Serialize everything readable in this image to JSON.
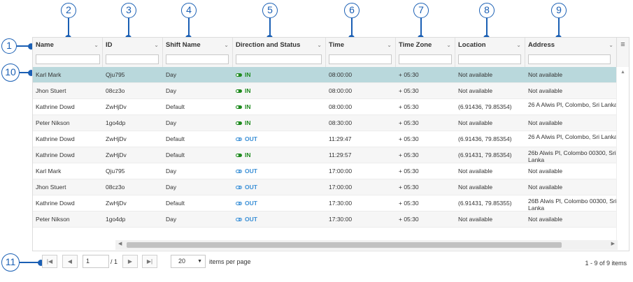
{
  "callouts": [
    "1",
    "2",
    "3",
    "4",
    "5",
    "6",
    "7",
    "8",
    "9",
    "10",
    "11"
  ],
  "columns": [
    {
      "label": "Name"
    },
    {
      "label": "ID"
    },
    {
      "label": "Shift Name"
    },
    {
      "label": "Direction and Status"
    },
    {
      "label": "Time"
    },
    {
      "label": "Time Zone"
    },
    {
      "label": "Location"
    },
    {
      "label": "Address"
    }
  ],
  "menu_icon": "hamburger-menu-icon",
  "rows": [
    {
      "name": "Karl Mark",
      "id": "Qju795",
      "shift": "Day",
      "status": "IN",
      "time": "08:00:00",
      "tz": "+ 05:30",
      "location": "Not available",
      "address": "Not available"
    },
    {
      "name": "Jhon Stuert",
      "id": "08cz3o",
      "shift": "Day",
      "status": "IN",
      "time": "08:00:00",
      "tz": "+ 05:30",
      "location": "Not available",
      "address": "Not available"
    },
    {
      "name": "Kathrine Dowd",
      "id": "ZwHjDv",
      "shift": "Default",
      "status": "IN",
      "time": "08:00:00",
      "tz": "+ 05:30",
      "location": "(6.91436, 79.85354)",
      "address": "26 A Alwis Pl, Colombo, Sri Lanka"
    },
    {
      "name": "Peter Nikson",
      "id": "1go4dp",
      "shift": "Day",
      "status": "IN",
      "time": "08:30:00",
      "tz": "+ 05:30",
      "location": "Not available",
      "address": "Not available"
    },
    {
      "name": "Kathrine Dowd",
      "id": "ZwHjDv",
      "shift": "Default",
      "status": "OUT",
      "time": "11:29:47",
      "tz": "+ 05:30",
      "location": "(6.91436, 79.85354)",
      "address": "26 A Alwis Pl, Colombo, Sri Lanka"
    },
    {
      "name": "Kathrine Dowd",
      "id": "ZwHjDv",
      "shift": "Default",
      "status": "IN",
      "time": "11:29:57",
      "tz": "+ 05:30",
      "location": "(6.91431, 79.85354)",
      "address": "26b Alwis Pl, Colombo 00300, Sri Lanka"
    },
    {
      "name": "Karl Mark",
      "id": "Qju795",
      "shift": "Day",
      "status": "OUT",
      "time": "17:00:00",
      "tz": "+ 05:30",
      "location": "Not available",
      "address": "Not available"
    },
    {
      "name": "Jhon Stuert",
      "id": "08cz3o",
      "shift": "Day",
      "status": "OUT",
      "time": "17:00:00",
      "tz": "+ 05:30",
      "location": "Not available",
      "address": "Not available"
    },
    {
      "name": "Kathrine Dowd",
      "id": "ZwHjDv",
      "shift": "Default",
      "status": "OUT",
      "time": "17:30:00",
      "tz": "+ 05:30",
      "location": "(6.91431, 79.85355)",
      "address": "26B Alwis Pl, Colombo 00300, Sri Lanka"
    },
    {
      "name": "Peter Nikson",
      "id": "1go4dp",
      "shift": "Day",
      "status": "OUT",
      "time": "17:30:00",
      "tz": "+ 05:30",
      "location": "Not available",
      "address": "Not available"
    }
  ],
  "selected_row": 0,
  "pager": {
    "current_page": "1",
    "page_of": "/ 1",
    "page_size": "20",
    "items_per_page_label": "items per page",
    "info": "1 - 9 of 9 items"
  },
  "colors": {
    "accent": "#1a5fb4",
    "selected_row": "#b9d8dc",
    "status_in": "#1e8a1e",
    "status_out": "#3a8fd6"
  }
}
